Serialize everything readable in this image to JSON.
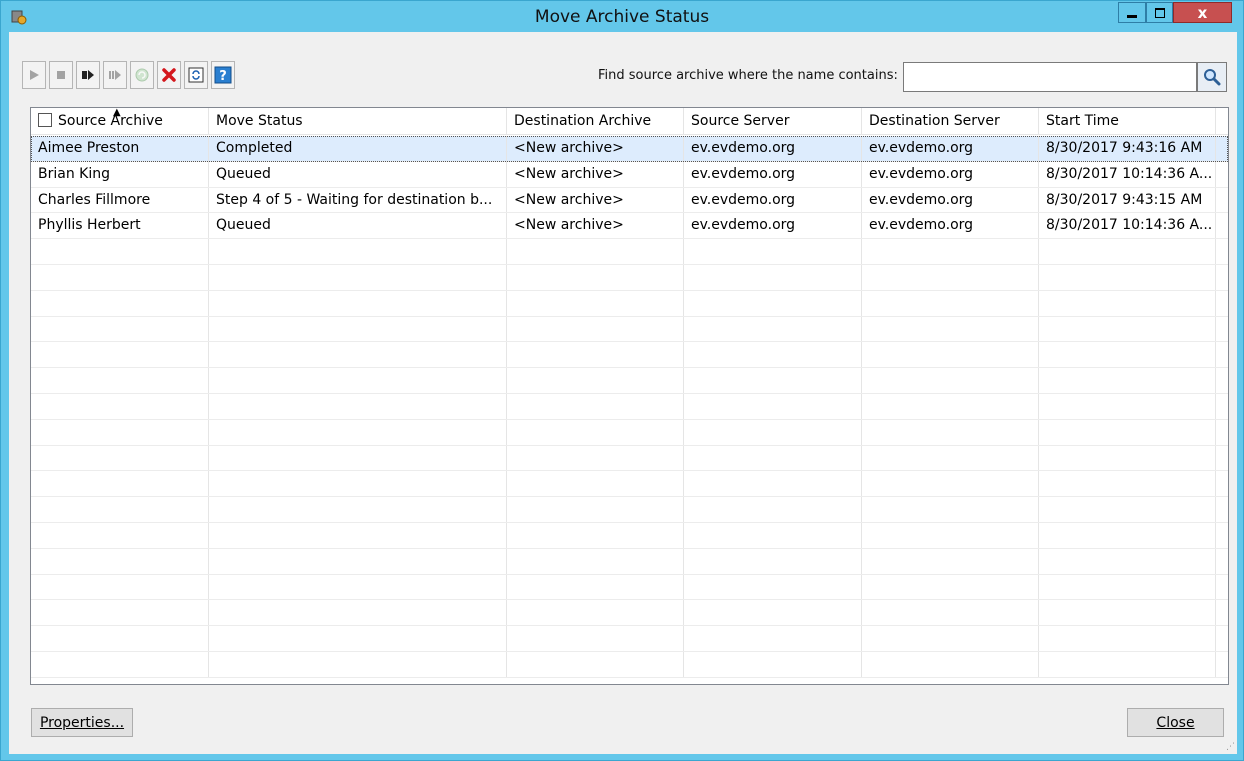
{
  "window": {
    "title": "Move Archive Status"
  },
  "toolbar": {
    "buttons": [
      {
        "icon": "play-icon",
        "enabled": false
      },
      {
        "icon": "stop-icon",
        "enabled": false
      },
      {
        "icon": "step-forward-icon",
        "enabled": true
      },
      {
        "icon": "skip-forward-icon",
        "enabled": false
      },
      {
        "icon": "retry-icon",
        "enabled": false
      },
      {
        "icon": "delete-icon",
        "enabled": true
      },
      {
        "icon": "refresh-icon",
        "enabled": true
      },
      {
        "icon": "help-icon",
        "enabled": true
      }
    ]
  },
  "search": {
    "label": "Find source archive where the name contains:",
    "value": "",
    "placeholder": ""
  },
  "table": {
    "columns": [
      "Source Archive",
      "Move Status",
      "Destination Archive",
      "Source Server",
      "Destination Server",
      "Start Time"
    ],
    "rows": [
      [
        "Aimee Preston",
        "Completed",
        "<New archive>",
        "ev.evdemo.org",
        "ev.evdemo.org",
        "8/30/2017 9:43:16 AM"
      ],
      [
        "Brian King",
        "Queued",
        "<New archive>",
        "ev.evdemo.org",
        "ev.evdemo.org",
        "8/30/2017 10:14:36 A..."
      ],
      [
        "Charles Fillmore",
        "Step 4 of 5 - Waiting for destination b...",
        "<New archive>",
        "ev.evdemo.org",
        "ev.evdemo.org",
        "8/30/2017 9:43:15 AM"
      ],
      [
        "Phyllis Herbert",
        "Queued",
        "<New archive>",
        "ev.evdemo.org",
        "ev.evdemo.org",
        "8/30/2017 10:14:36 A..."
      ]
    ],
    "selected_row": 0
  },
  "buttons": {
    "properties": "Properties...",
    "close": "Close"
  },
  "colors": {
    "titlebar": "#63c7ea",
    "close_button": "#c75050",
    "selection": "#ddecfd"
  }
}
